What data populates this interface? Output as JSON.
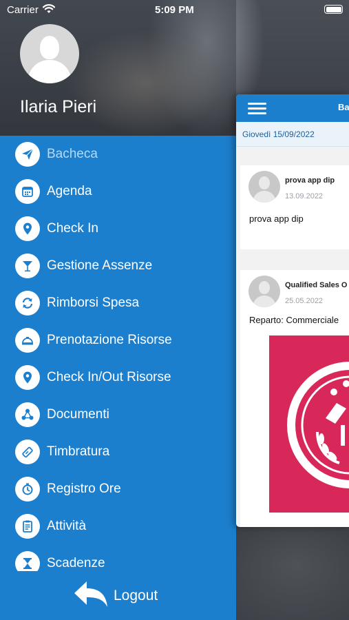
{
  "status_bar": {
    "carrier": "Carrier",
    "time": "5:09 PM"
  },
  "drawer": {
    "user_name": "Ilaria Pieri",
    "menu": [
      {
        "label": "Bacheca",
        "icon": "paper-plane-icon",
        "active": true
      },
      {
        "label": "Agenda",
        "icon": "calendar-icon"
      },
      {
        "label": "Check In",
        "icon": "location-pin-icon"
      },
      {
        "label": "Gestione Assenze",
        "icon": "cocktail-icon"
      },
      {
        "label": "Rimborsi Spesa",
        "icon": "refund-icon"
      },
      {
        "label": "Prenotazione Risorse",
        "icon": "service-bell-icon"
      },
      {
        "label": "Check In/Out Risorse",
        "icon": "location-pin-icon"
      },
      {
        "label": "Documenti",
        "icon": "share-icon"
      },
      {
        "label": "Timbratura",
        "icon": "badge-card-icon"
      },
      {
        "label": "Registro Ore",
        "icon": "stopwatch-icon"
      },
      {
        "label": "Attività",
        "icon": "clipboard-icon"
      },
      {
        "label": "Scadenze",
        "icon": "hourglass-icon"
      }
    ],
    "logout_label": "Logout"
  },
  "main": {
    "title": "Ba",
    "date": "Giovedì 15/09/2022",
    "posts": [
      {
        "author": "prova app dip",
        "date": "13.09.2022",
        "body": "prova app dip"
      },
      {
        "author": "Qualified Sales O",
        "date": "25.05.2022",
        "body": "Reparto: Commerciale"
      }
    ]
  },
  "colors": {
    "brand_blue": "#1c7fce",
    "badge_red": "#d8285a"
  }
}
